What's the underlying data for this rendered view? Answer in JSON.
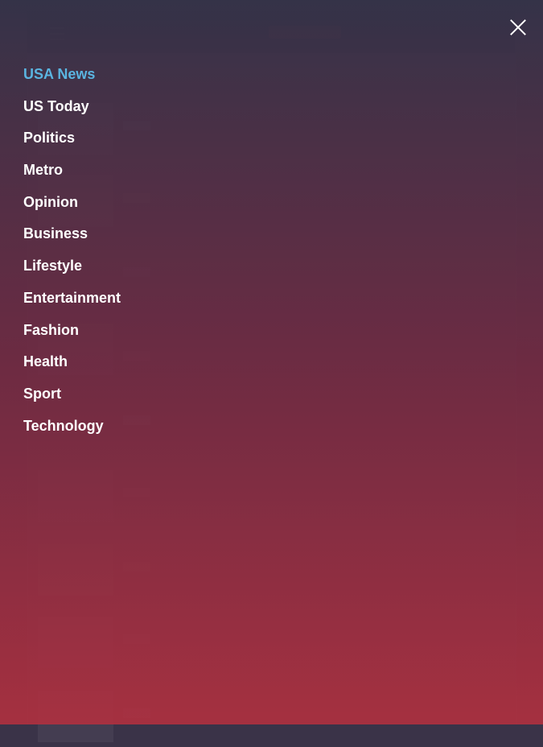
{
  "colors": {
    "overlay_top": "#343248",
    "overlay_bottom": "#a83040",
    "menu_text": "#ffffff",
    "menu_active": "#5ab4e0"
  },
  "close_icon": "close-icon",
  "menu": {
    "items": [
      {
        "label": "USA News",
        "active": true
      },
      {
        "label": "US Today",
        "active": false
      },
      {
        "label": "Politics",
        "active": false
      },
      {
        "label": "Metro",
        "active": false
      },
      {
        "label": "Opinion",
        "active": false
      },
      {
        "label": "Business",
        "active": false
      },
      {
        "label": "Lifestyle",
        "active": false
      },
      {
        "label": "Entertainment",
        "active": false
      },
      {
        "label": "Fashion",
        "active": false
      },
      {
        "label": "Health",
        "active": false
      },
      {
        "label": "Sport",
        "active": false
      },
      {
        "label": "Technology",
        "active": false
      }
    ]
  }
}
